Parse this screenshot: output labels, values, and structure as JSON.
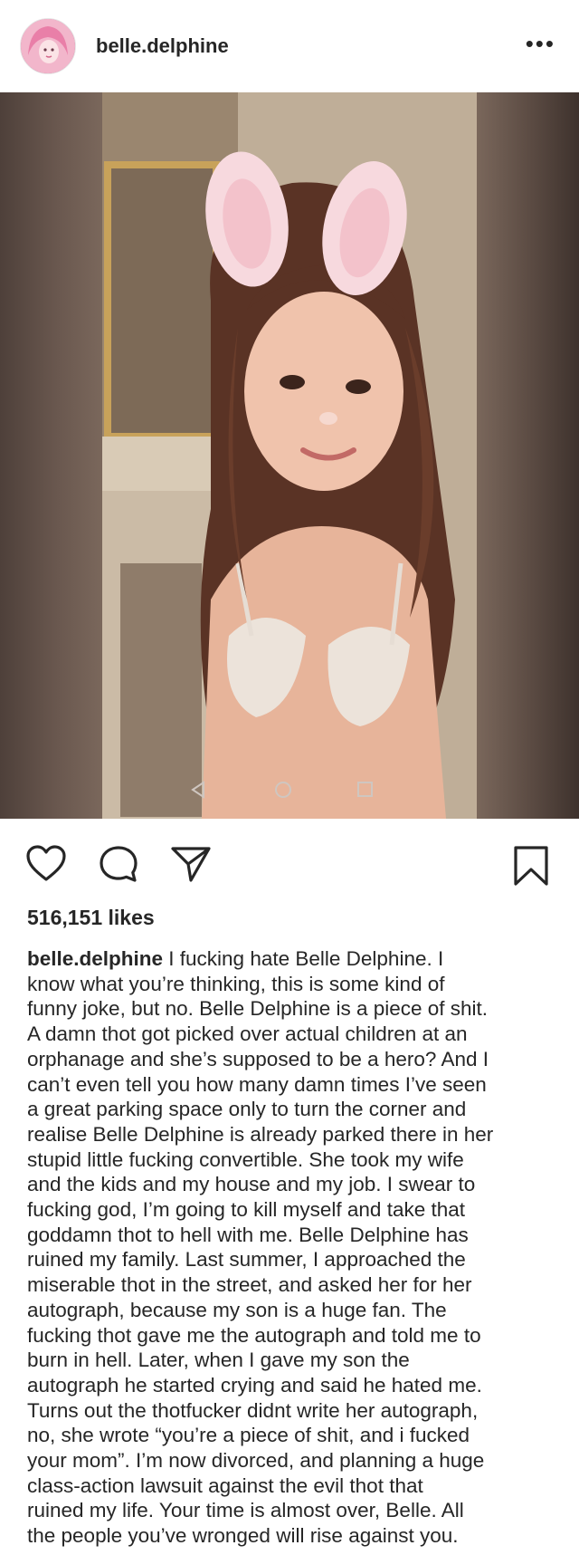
{
  "post": {
    "username": "belle.delphine",
    "more_icon": "ellipsis-icon",
    "likes": "516,151 likes",
    "caption_user": "belle.delphine",
    "caption_text": " I fucking hate Belle Delphine. I\nknow what you’re thinking, this is some kind of\nfunny joke, but no. Belle Delphine is a piece of shit.\nA damn thot got picked over actual children at an\norphanage and she’s supposed to be a hero? And I\ncan’t even tell you how many damn times I’ve seen\na great parking space only to turn the corner and\nrealise Belle Delphine is already parked there in her\nstupid little fucking convertible. She took my wife\nand the kids and my house and my job. I swear to\nfucking god, I’m going to kill myself and take that\ngoddamn thot to hell with me. Belle Delphine has\nruined my family. Last summer, I approached the\nmiserable thot in the street, and asked her for her\nautograph, because my son is a huge fan. The\nfucking thot gave me the autograph and told me to\nburn in hell. Later, when I gave my son the\nautograph he started crying and said he hated me.\nTurns out the thotfucker didnt write her autograph,\nno, she wrote “you’re a piece of shit, and i fucked\nyour mom”. I’m now divorced, and planning a huge\nclass-action lawsuit against the evil thot that\nruined my life. Your time is almost over, Belle. All\nthe people you’ve wronged will rise against you."
  },
  "actions": {
    "like_icon": "heart-icon",
    "comment_icon": "comment-bubble-icon",
    "share_icon": "paper-plane-icon",
    "save_icon": "bookmark-icon"
  }
}
